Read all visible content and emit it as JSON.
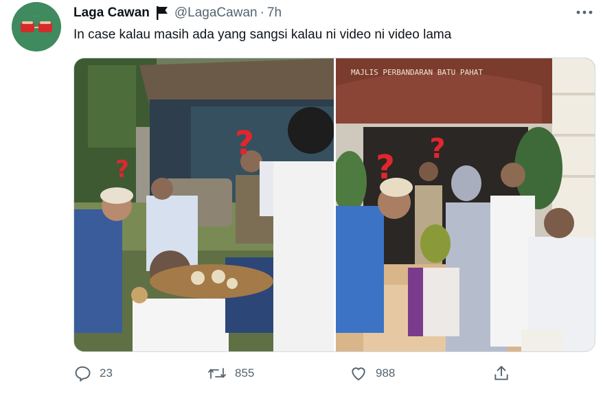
{
  "tweet": {
    "display_name": "Laga Cawan",
    "handle": "@LagaCawan",
    "separator": "·",
    "time": "7h",
    "text": "In case kalau masih ada yang sangsi kalau ni video ni video lama"
  },
  "media": {
    "left_photo_icon": "question-mark-icon",
    "right_photo_sign": "MAJLIS PERBANDARAN BATU PAHAT"
  },
  "actions": {
    "reply_count": "23",
    "retweet_count": "855",
    "like_count": "988"
  },
  "colors": {
    "text_primary": "#0f1419",
    "text_secondary": "#536471",
    "border": "#cfd9de",
    "question_mark": "#e0262e",
    "avatar_bg": "#3f8a5f"
  }
}
